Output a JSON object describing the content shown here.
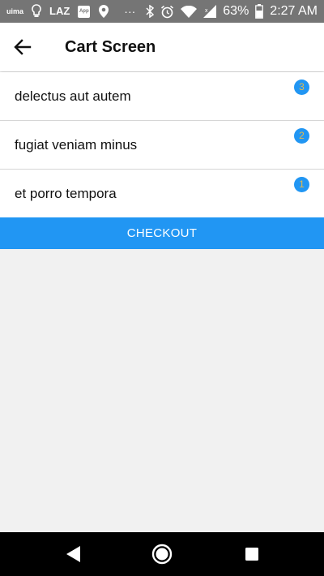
{
  "status_bar": {
    "left_app_label": "uima",
    "laz_label": "LAZ",
    "app_label": "App",
    "dots": "···",
    "battery_percent": "63%",
    "time": "2:27 AM",
    "icons": [
      "bulb-icon",
      "laz-icon",
      "app-notification-icon",
      "location-icon",
      "more-dots-icon",
      "bluetooth-icon",
      "alarm-icon",
      "wifi-icon",
      "signal-icon",
      "battery-icon"
    ]
  },
  "app_bar": {
    "title": "Cart Screen",
    "back_icon": "arrow-left-icon"
  },
  "cart": {
    "items": [
      {
        "name": "delectus aut autem",
        "quantity": "3"
      },
      {
        "name": "fugiat veniam minus",
        "quantity": "2"
      },
      {
        "name": "et porro tempora",
        "quantity": "1"
      }
    ],
    "checkout_label": "CHECKOUT"
  },
  "nav_bar": {
    "icons": [
      "nav-back-icon",
      "nav-home-icon",
      "nav-recents-icon"
    ]
  },
  "colors": {
    "accent": "#2196F3",
    "badge_text": "#e6b94a",
    "status_bar": "#757575",
    "background": "#f1f1f1"
  }
}
